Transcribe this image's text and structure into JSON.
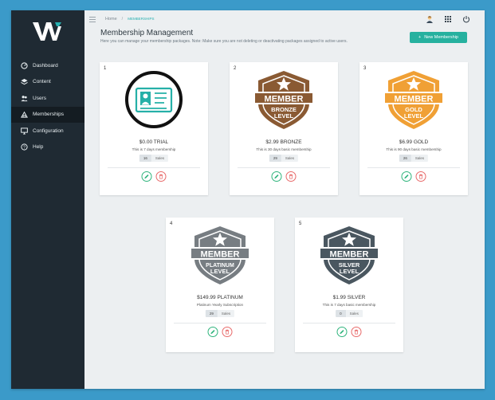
{
  "breadcrumb": {
    "home": "Home",
    "separator": "/",
    "current": "MEMBERSHIPS"
  },
  "sidebar": {
    "items": [
      {
        "label": "Dashboard",
        "icon": "dashboard-icon"
      },
      {
        "label": "Content",
        "icon": "layers-icon"
      },
      {
        "label": "Users",
        "icon": "users-icon"
      },
      {
        "label": "Memberships",
        "icon": "membership-icon",
        "active": true
      },
      {
        "label": "Configuration",
        "icon": "monitor-icon"
      },
      {
        "label": "Help",
        "icon": "help-icon"
      }
    ]
  },
  "header": {
    "title": "Membership Management",
    "subtitle": "Here you can manage your membership packages. Note: Make sure you are not deleting or deactivating packages assigned to active users.",
    "new_button": "New Membership",
    "new_button_icon": "+"
  },
  "badge_text": {
    "member": "MEMBER",
    "level": "LEVEL"
  },
  "cards": [
    {
      "number": "1",
      "price": "$0.00 TRIAL",
      "description": "This is 7 days membership",
      "sales": "16",
      "sales_label": "Sales",
      "tier": "",
      "color": "#26b0a8"
    },
    {
      "number": "2",
      "price": "$2.99 BRONZE",
      "description": "This is 30 days basic membership",
      "sales": "29",
      "sales_label": "Sales",
      "tier": "BRONZE",
      "color": "#8a5a33"
    },
    {
      "number": "3",
      "price": "$6.99 GOLD",
      "description": "This is 90 days basic membership",
      "sales": "26",
      "sales_label": "Sales",
      "tier": "GOLD",
      "color": "#f0a035"
    },
    {
      "number": "4",
      "price": "$149.99 PLATINUM",
      "description": "Platinum Yearly Subscription",
      "sales": "29",
      "sales_label": "Sales",
      "tier": "PLATINUM",
      "color": "#777d82"
    },
    {
      "number": "5",
      "price": "$1.99 SILVER",
      "description": "This is 7 days basic membership",
      "sales": "0",
      "sales_label": "Sales",
      "tier": "SILVER",
      "color": "#4a5760"
    }
  ],
  "colors": {
    "accent": "#26b19f",
    "sidebar": "#1f2a33",
    "edit": "#2fb47c",
    "delete": "#e86a6a"
  }
}
